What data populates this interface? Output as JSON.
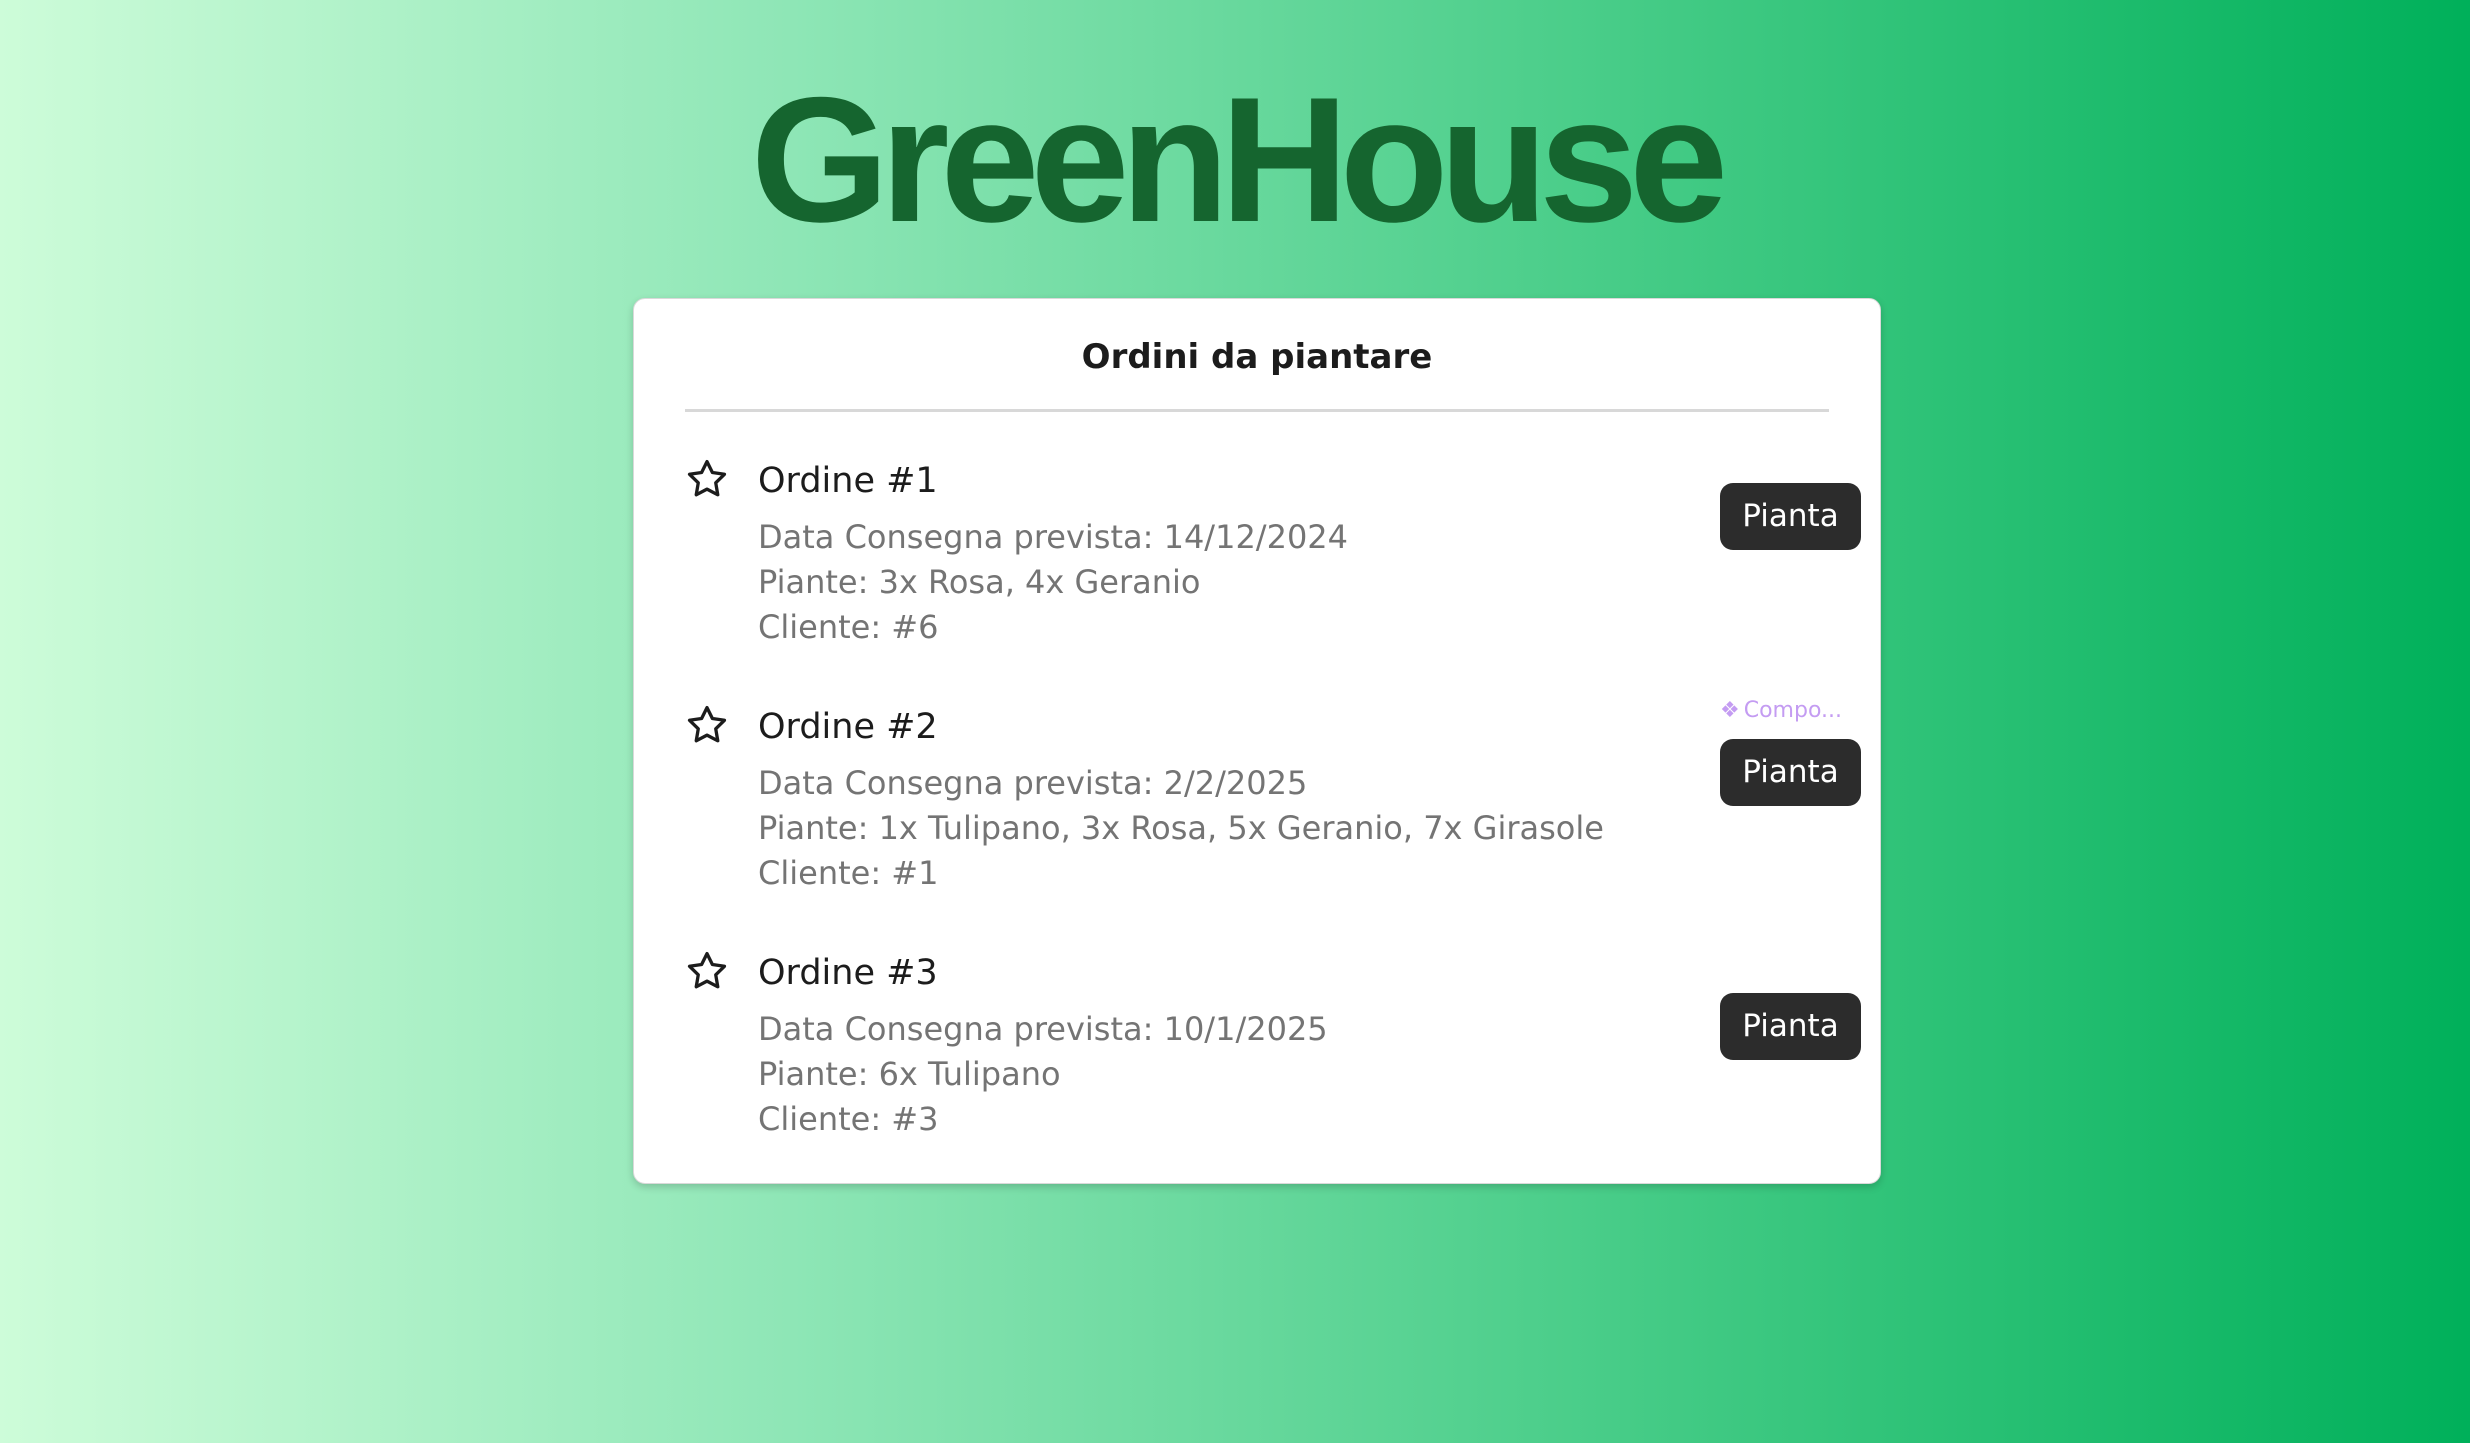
{
  "app": {
    "title": "GreenHouse"
  },
  "card": {
    "title": "Ordini da piantare"
  },
  "orders": [
    {
      "name": "Ordine #1",
      "delivery": "Data Consegna prevista: 14/12/2024",
      "plants": "Piante: 3x Rosa, 4x Geranio",
      "client": "Cliente: #6",
      "button_label": "Pianta",
      "icon": "star-outline-icon"
    },
    {
      "name": "Ordine #2",
      "delivery": "Data Consegna prevista: 2/2/2025",
      "plants": "Piante: 1x Tulipano, 3x Rosa, 5x Geranio, 7x Girasole",
      "client": "Cliente: #1",
      "button_label": "Pianta",
      "icon": "star-outline-icon",
      "component_tag": "Compo...",
      "component_icon": "component-diamond-icon"
    },
    {
      "name": "Ordine #3",
      "delivery": "Data Consegna prevista: 10/1/2025",
      "plants": "Piante: 6x Tulipano",
      "client": "Cliente: #3",
      "button_label": "Pianta",
      "icon": "star-outline-icon"
    }
  ],
  "colors": {
    "title": "#15652f",
    "button_bg": "#2c2c2c",
    "button_text": "#ffffff",
    "detail_text": "#747474",
    "component_tag": "#c49cf2",
    "gradient_start": "#cdfcd9",
    "gradient_end": "#00b05a"
  }
}
